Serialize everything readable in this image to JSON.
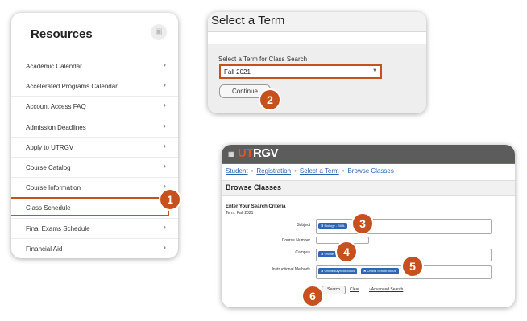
{
  "resources": {
    "title": "Resources",
    "icon": "briefcase-icon",
    "items": [
      {
        "label": "Academic Calendar"
      },
      {
        "label": "Accelerated Programs Calendar"
      },
      {
        "label": "Account Access FAQ"
      },
      {
        "label": "Admission Deadlines"
      },
      {
        "label": "Apply to UTRGV"
      },
      {
        "label": "Course Catalog"
      },
      {
        "label": "Course Information"
      },
      {
        "label": "Class Schedule",
        "highlighted": true
      },
      {
        "label": "Final Exams Schedule"
      },
      {
        "label": "Financial Aid"
      }
    ]
  },
  "term": {
    "title": "Select a Term",
    "label": "Select a Term for Class Search",
    "selected": "Fall 2021",
    "continue": "Continue"
  },
  "browse": {
    "brand_ut": "UT",
    "brand_rest": "RGV",
    "breadcrumbs": [
      "Student",
      "Registration",
      "Select a Term",
      "Browse Classes"
    ],
    "heading": "Browse Classes",
    "criteria_title": "Enter Your Search Criteria",
    "term_line": "Term: Fall 2021",
    "subject_label": "Subject",
    "subject_chip": "Biology - BIOL",
    "course_number_label": "Course Number",
    "campus_label": "Campus",
    "campus_chip": "Online",
    "methods_label": "Instructional Methods",
    "methods_chips": [
      "Online Asynchronous",
      "Online Synchronous"
    ],
    "search": "Search",
    "clear": "Clear",
    "advanced": "Advanced Search"
  },
  "badges": [
    "1",
    "2",
    "3",
    "4",
    "5",
    "6"
  ],
  "colors": {
    "accent": "#c6501e",
    "chip": "#2e66b5",
    "link": "#2a63a8",
    "topbar": "#5c5c5c"
  }
}
